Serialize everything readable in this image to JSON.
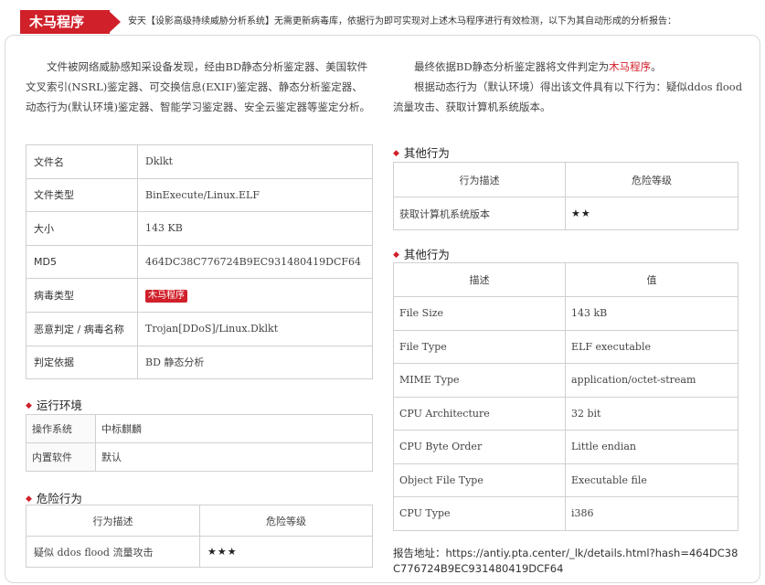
{
  "header": {
    "tag": "木马程序",
    "text": "安天【设影高级持续威胁分析系统】无需更新病毒库，依据行为即可实现对上述木马程序进行有效检测，以下为其自动形成的分析报告："
  },
  "intro": {
    "left": "文件被网络威胁感知采设备发现，经由BD静态分析鉴定器、美国软件文叉索引(NSRL)鉴定器、可交换信息(EXIF)鉴定器、静态分析鉴定器、动态行为(默认环境)鉴定器、智能学习鉴定器、安全云鉴定器等鉴定分析。",
    "right_line1_prefix": "最终依据BD静态分析鉴定器将文件判定为",
    "right_line1_red": "木马程序",
    "right_line1_suffix": "。",
    "right_line2": "根据动态行为（默认环境）得出该文件具有以下行为：疑似ddos flood流量攻击、获取计算机系统版本。"
  },
  "info_table": {
    "rows": [
      {
        "key": "文件名",
        "value": "Dklkt"
      },
      {
        "key": "文件类型",
        "value": "BinExecute/Linux.ELF"
      },
      {
        "key": "大小",
        "value": "143 KB"
      },
      {
        "key": "MD5",
        "value": "464DC38C776724B9EC931480419DCF64"
      },
      {
        "key": "病毒类型",
        "value": "木马程序"
      },
      {
        "key": "恶意判定 / 病毒名称",
        "value": "Trojan[DDoS]/Linux.Dklkt"
      },
      {
        "key": "判定依据",
        "value": "BD 静态分析"
      }
    ]
  },
  "env": {
    "title": "运行环境",
    "rows": [
      {
        "key": "操作系统",
        "value": "中标麒麟"
      },
      {
        "key": "内置软件",
        "value": "默认"
      }
    ]
  },
  "danger": {
    "title": "危险行为",
    "headers": [
      "行为描述",
      "危险等级"
    ],
    "rows": [
      {
        "desc": "疑似 ddos flood 流量攻击",
        "level": "★★★"
      }
    ]
  },
  "other": {
    "title": "其他行为",
    "headers": [
      "行为描述",
      "危险等级"
    ],
    "rows": [
      {
        "desc": "获取计算机系统版本",
        "level": "★★"
      }
    ]
  },
  "attrs": {
    "title": "其他行为",
    "headers": [
      "描述",
      "值"
    ],
    "rows": [
      {
        "key": "File Size",
        "value": "143 kB"
      },
      {
        "key": "File Type",
        "value": "ELF executable"
      },
      {
        "key": "MIME Type",
        "value": "application/octet-stream"
      },
      {
        "key": "CPU Architecture",
        "value": "32 bit"
      },
      {
        "key": "CPU Byte Order",
        "value": "Little endian"
      },
      {
        "key": "Object File Type",
        "value": "Executable file"
      },
      {
        "key": "CPU Type",
        "value": "i386"
      }
    ]
  },
  "report": {
    "label": "报告地址：",
    "url": "https://antiy.pta.center/_lk/details.html?hash=464DC38C776724B9EC931480419DCF64"
  },
  "colors": {
    "accent": "#d0202a",
    "border": "#d0d0d0"
  }
}
